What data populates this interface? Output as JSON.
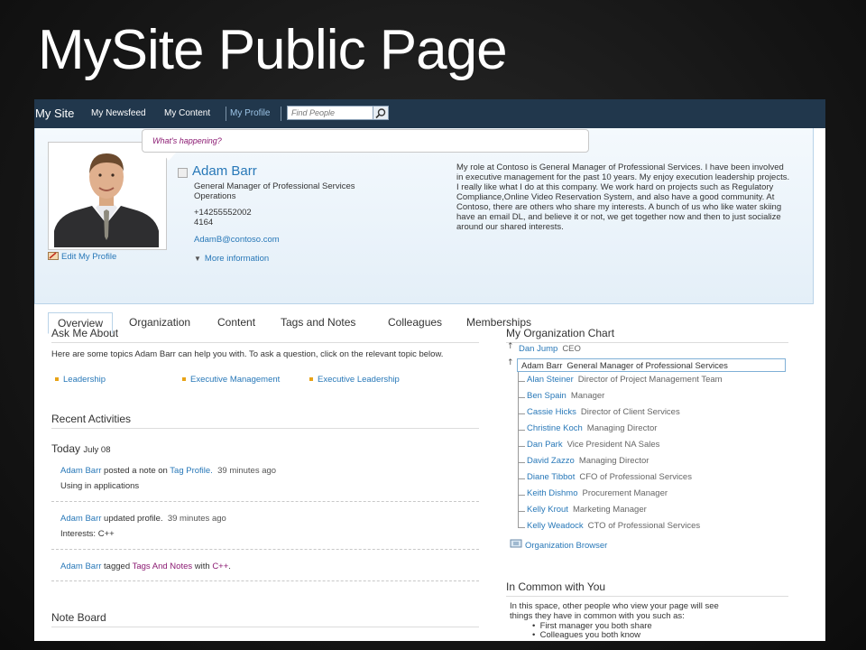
{
  "slide_title": "MySite Public Page",
  "topbar": {
    "site": "My Site",
    "nav": [
      "My Newsfeed",
      "My Content",
      "My Profile"
    ],
    "active": "My Profile",
    "search_placeholder": "Find People"
  },
  "status_prompt": "What's happening?",
  "profile": {
    "name": "Adam Barr",
    "title_line1": "General Manager of Professional Services",
    "title_line2": "Operations",
    "phone": "+14255552002",
    "ext": "4164",
    "email": "AdamB@contoso.com",
    "edit_profile": "Edit My Profile",
    "more_info": "More information",
    "bio": "My role at Contoso is General Manager of Professional Services. I have been involved in executive management for the past 10 years. My enjoy execution leadership projects. I really like what I do at this company. We work hard on projects such as Regulatory Compliance,Online Video Reservation System, and also have a good community. At Contoso, there are others who share my interests. A bunch of us who like water skiing have an email DL, and believe it or not, we get together now and then to just socialize around our shared interests."
  },
  "tabs": [
    "Overview",
    "Organization",
    "Content",
    "Tags and Notes",
    "Colleagues",
    "Memberships"
  ],
  "ask_me_about": {
    "title": "Ask Me About",
    "description": "Here are some topics Adam Barr can help you with. To ask a question, click on the relevant topic below.",
    "topics": [
      "Leadership",
      "Executive Management",
      "Executive Leadership"
    ]
  },
  "recent_activities": {
    "title": "Recent Activities",
    "day": "Today",
    "date": "July 08",
    "items": [
      {
        "actor": "Adam Barr",
        "verb": " posted a note on ",
        "object": "Tag Profile.",
        "suffix": "",
        "time": "39 minutes ago",
        "detail": "Using in applications"
      },
      {
        "actor": "Adam Barr",
        "verb": " updated profile.",
        "object": "",
        "suffix": "",
        "time": "39 minutes ago",
        "detail": "Interests: C++"
      },
      {
        "actor": "Adam Barr",
        "verb": " tagged ",
        "object": "Tags And Notes",
        "suffix": " with ",
        "object2": "C++",
        "end": ".",
        "time": "",
        "detail": ""
      }
    ]
  },
  "note_board": {
    "title": "Note Board"
  },
  "org_chart": {
    "title": "My Organization Chart",
    "manager": {
      "name": "Dan Jump",
      "role": "CEO"
    },
    "self": {
      "name": "Adam Barr",
      "role": "General Manager of Professional Services"
    },
    "reports": [
      {
        "name": "Alan Steiner",
        "role": "Director of Project Management Team"
      },
      {
        "name": "Ben Spain",
        "role": "Manager"
      },
      {
        "name": "Cassie Hicks",
        "role": "Director of Client Services"
      },
      {
        "name": "Christine Koch",
        "role": "Managing Director"
      },
      {
        "name": "Dan Park",
        "role": "Vice President NA Sales"
      },
      {
        "name": "David Zazzo",
        "role": "Managing Director"
      },
      {
        "name": "Diane Tibbot",
        "role": "CFO of Professional Services"
      },
      {
        "name": "Keith Dishmo",
        "role": "Procurement Manager"
      },
      {
        "name": "Kelly Krout",
        "role": "Marketing Manager"
      },
      {
        "name": "Kelly Weadock",
        "role": "CTO of Professional Services"
      }
    ],
    "browser": "Organization Browser"
  },
  "in_common": {
    "title": "In Common with You",
    "line1": "In this space, other people who view your page will see",
    "line2": "things they have in common with you such as:",
    "bullets": [
      "First manager you both share",
      "Colleagues you both know"
    ]
  }
}
